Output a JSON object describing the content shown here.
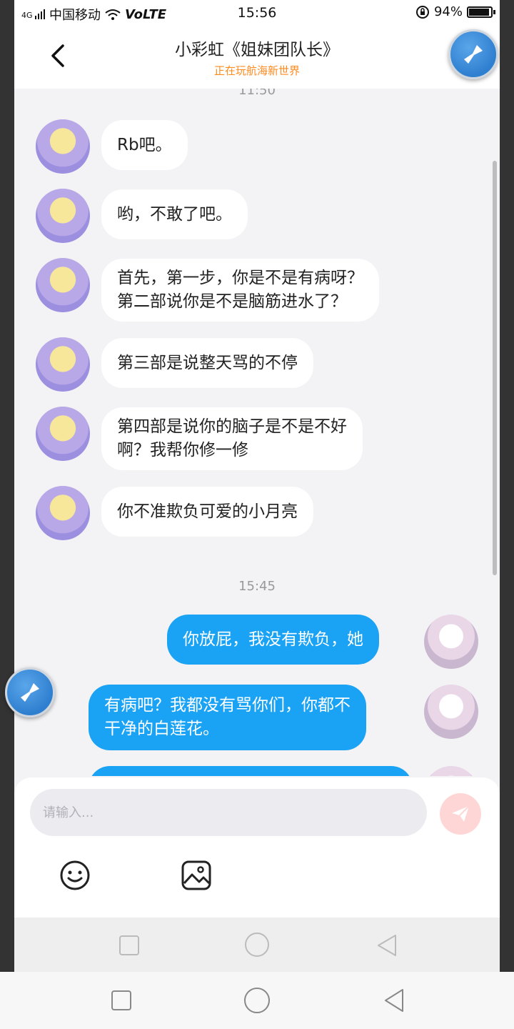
{
  "status_bar": {
    "network": "4G",
    "carrier": "中国移动",
    "volte": "VoLTE",
    "time": "15:56",
    "battery_percent": "94%",
    "battery_level": 0.94
  },
  "header": {
    "title": "小彩虹《姐妹团队长》",
    "subtitle": "正在玩航海新世界"
  },
  "chat": {
    "top_partial_time": "11:50",
    "time_divider": "15:45",
    "messages": [
      {
        "from": "other",
        "text": "Rb吧。"
      },
      {
        "from": "other",
        "text": "哟，不敢了吧。"
      },
      {
        "from": "other",
        "lines": [
          "首先，第一步，你是不是有病呀？",
          "第二部说你是不是脑筋进水了？"
        ]
      },
      {
        "from": "other",
        "text": "第三部是说整天骂的不停"
      },
      {
        "from": "other",
        "lines": [
          "第四部是说你的脑子是不是不好",
          "啊？我帮你修一修"
        ]
      },
      {
        "from": "other",
        "text": "你不准欺负可爱的小月亮"
      },
      {
        "from": "me",
        "text": "你放屁，我没有欺负，她"
      },
      {
        "from": "me",
        "lines": [
          "有病吧？我都没有骂你们，你都不",
          "干净的白莲花。"
        ]
      }
    ]
  },
  "composer": {
    "placeholder": "请输入..."
  },
  "icons": {
    "back": "back-arrow-icon",
    "floating": "broom-icon",
    "emoji": "emoji-icon",
    "image": "image-icon",
    "send": "send-icon",
    "recents": "recents-square-icon",
    "home": "home-circle-icon",
    "nav_back": "back-triangle-icon"
  },
  "colors": {
    "accent_orange": "#ff8a1f",
    "outgoing_bubble": "#1aa3f5",
    "send_button": "#ffd6d6"
  }
}
